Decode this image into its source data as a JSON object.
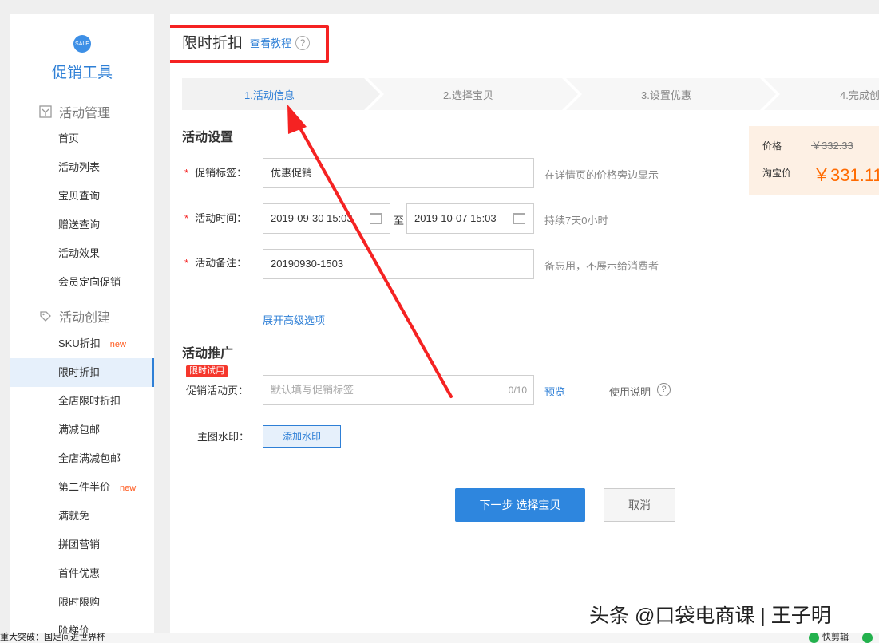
{
  "sidebar": {
    "logo_text": "SALE",
    "brand": "促销工具",
    "groups": [
      {
        "title": "活动管理",
        "icon": "manage-icon"
      },
      {
        "title": "活动创建",
        "icon": "create-icon"
      }
    ],
    "manage_items": [
      "首页",
      "活动列表",
      "宝贝查询",
      "赠送查询",
      "活动效果",
      "会员定向促销"
    ],
    "create_items": [
      {
        "label": "SKU折扣",
        "badge": "new"
      },
      {
        "label": "限时折扣",
        "badge": ""
      },
      {
        "label": "全店限时折扣",
        "badge": ""
      },
      {
        "label": "满减包邮",
        "badge": ""
      },
      {
        "label": "全店满减包邮",
        "badge": ""
      },
      {
        "label": "第二件半价",
        "badge": "new"
      },
      {
        "label": "满就免",
        "badge": ""
      },
      {
        "label": "拼团营销",
        "badge": ""
      },
      {
        "label": "首件优惠",
        "badge": ""
      },
      {
        "label": "限时限购",
        "badge": ""
      },
      {
        "label": "阶梯价",
        "badge": ""
      }
    ],
    "active_item": "限时折扣"
  },
  "header": {
    "title": "限时折扣",
    "tutorial_link": "查看教程",
    "help_glyph": "?"
  },
  "steps": [
    {
      "label": "1.活动信息",
      "current": true
    },
    {
      "label": "2.选择宝贝",
      "current": false
    },
    {
      "label": "3.设置优惠",
      "current": false
    },
    {
      "label": "4.完成创",
      "current": false
    }
  ],
  "activity_settings": {
    "section_title": "活动设置",
    "tag_label": "促销标签：",
    "tag_value": "优惠促销",
    "tag_hint": "在详情页的价格旁边显示",
    "time_label": "活动时间：",
    "start_time": "2019-09-30 15:03",
    "time_separator": "至",
    "end_time": "2019-10-07 15:03",
    "duration_hint": "持续7天0小时",
    "note_label": "活动备注：",
    "note_value": "20190930-1503",
    "note_hint": "备忘用，不展示给消费者",
    "advanced_link": "展开高级选项"
  },
  "promotion": {
    "section_title": "活动推广",
    "limited_badge": "限时试用",
    "page_label": "促销活动页：",
    "page_placeholder": "默认填写促销标签",
    "page_counter": "0/10",
    "preview_link": "预览",
    "usage_label": "使用说明",
    "watermark_label": "主图水印：",
    "watermark_button": "添加水印"
  },
  "actions": {
    "next_button": "下一步 选择宝贝",
    "cancel_button": "取消"
  },
  "price_preview": {
    "price_label": "价格",
    "original_price": "￥332.33",
    "taobao_label": "淘宝价",
    "discount_price": "￥331.11"
  },
  "overlay": {
    "watermark_text": "头条 @口袋电商课 | 王子明",
    "annotation_color": "#f52222"
  },
  "statusbar": {
    "news_text": "重大突破：国足间进世界杯",
    "app_label": "快剪辑"
  },
  "colors": {
    "accent": "#2e7fd6",
    "danger": "#f52222",
    "price": "#ff6a00"
  }
}
